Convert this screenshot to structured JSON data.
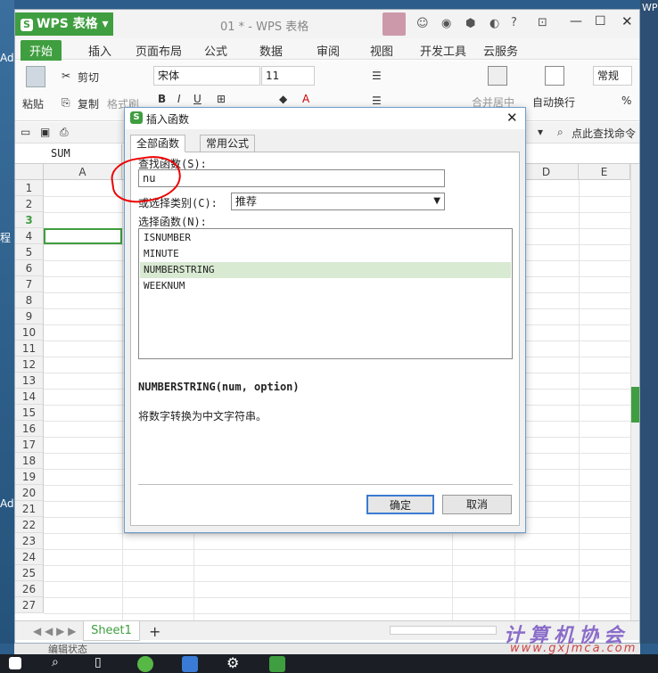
{
  "desktop": {
    "left_items": [
      "Ad",
      "程",
      "Ad"
    ],
    "right_text": "WPS"
  },
  "window": {
    "app_button": "WPS 表格",
    "title": "01 * - WPS 表格",
    "ribbon_tabs": [
      "开始",
      "插入",
      "页面布局",
      "公式",
      "数据",
      "审阅",
      "视图",
      "开发工具",
      "云服务"
    ],
    "active_tab": "开始",
    "ribbon": {
      "cut": "剪切",
      "paste": "粘贴",
      "copy": "复制",
      "format_painter": "格式刷",
      "font": "宋体",
      "size": "11",
      "merge": "合并居中",
      "wrap": "自动换行",
      "number_format": "常规",
      "percent": "%"
    },
    "quick_search": "点此查找命令",
    "name_box": "SUM",
    "columns": [
      "A",
      "D",
      "E"
    ],
    "rows": [
      "1",
      "2",
      "3",
      "4",
      "5",
      "6",
      "7",
      "8",
      "9",
      "10",
      "11",
      "12",
      "13",
      "14",
      "15",
      "16",
      "17",
      "18",
      "19",
      "20",
      "21",
      "22",
      "23",
      "24",
      "25",
      "26",
      "27"
    ],
    "sheet_tab": "Sheet1",
    "status_text": "编辑状态"
  },
  "dialog": {
    "title": "插入函数",
    "tabs": [
      "全部函数",
      "常用公式"
    ],
    "search_label": "查找函数(S):",
    "search_value": "nu",
    "category_label": "或选择类别(C):",
    "category_value": "推荐",
    "select_label": "选择函数(N):",
    "functions": [
      "ISNUMBER",
      "MINUTE",
      "NUMBERSTRING",
      "WEEKNUM"
    ],
    "selected_function": "NUMBERSTRING",
    "signature": "NUMBERSTRING(num, option)",
    "description": "将数字转换为中文字符串。",
    "ok": "确定",
    "cancel": "取消"
  },
  "watermark": {
    "line1": "计算机协会",
    "line2": "www.gxjmca.com"
  },
  "colors": {
    "accent": "#3f9e3f",
    "selection": "#d9ead3",
    "annotation": "#e00000"
  }
}
